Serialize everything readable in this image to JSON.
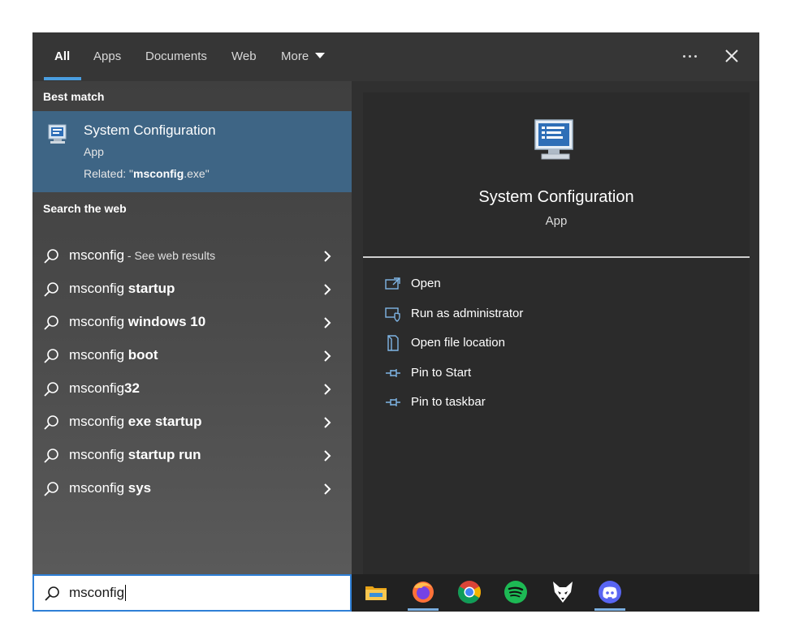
{
  "tabs": [
    {
      "label": "All",
      "active": true
    },
    {
      "label": "Apps"
    },
    {
      "label": "Documents"
    },
    {
      "label": "Web"
    },
    {
      "label": "More"
    }
  ],
  "best_match": {
    "heading": "Best match",
    "title": "System Configuration",
    "type": "App",
    "related_prefix": "Related: \"",
    "related_bold": "msconfig",
    "related_suffix": ".exe\""
  },
  "web": {
    "heading": "Search the web",
    "suggestions": [
      {
        "query": "msconfig",
        "bold": "",
        "hint": " - See web results"
      },
      {
        "query": "msconfig ",
        "bold": "startup",
        "hint": ""
      },
      {
        "query": "msconfig ",
        "bold": "windows 10",
        "hint": ""
      },
      {
        "query": "msconfig ",
        "bold": "boot",
        "hint": ""
      },
      {
        "query": "msconfig",
        "bold": "32",
        "hint": ""
      },
      {
        "query": "msconfig ",
        "bold": "exe startup",
        "hint": ""
      },
      {
        "query": "msconfig ",
        "bold": "startup run",
        "hint": ""
      },
      {
        "query": "msconfig ",
        "bold": "sys",
        "hint": ""
      }
    ]
  },
  "detail": {
    "title": "System Configuration",
    "type": "App",
    "actions": [
      {
        "label": "Open",
        "icon": "open-icon"
      },
      {
        "label": "Run as administrator",
        "icon": "shield-icon"
      },
      {
        "label": "Open file location",
        "icon": "file-location-icon"
      },
      {
        "label": "Pin to Start",
        "icon": "pin-icon"
      },
      {
        "label": "Pin to taskbar",
        "icon": "pin-icon"
      }
    ]
  },
  "search": {
    "value": "msconfig"
  },
  "taskbar": {
    "apps": [
      {
        "name": "file-explorer-icon",
        "active": false
      },
      {
        "name": "firefox-icon",
        "active": true
      },
      {
        "name": "chrome-icon",
        "active": false
      },
      {
        "name": "spotify-icon",
        "active": false
      },
      {
        "name": "fox-app-icon",
        "active": false
      },
      {
        "name": "discord-icon",
        "active": true
      }
    ]
  },
  "colors": {
    "accent": "#4a9ee0",
    "best_match_bg": "#3e6585",
    "search_border": "#2f7fd6"
  }
}
